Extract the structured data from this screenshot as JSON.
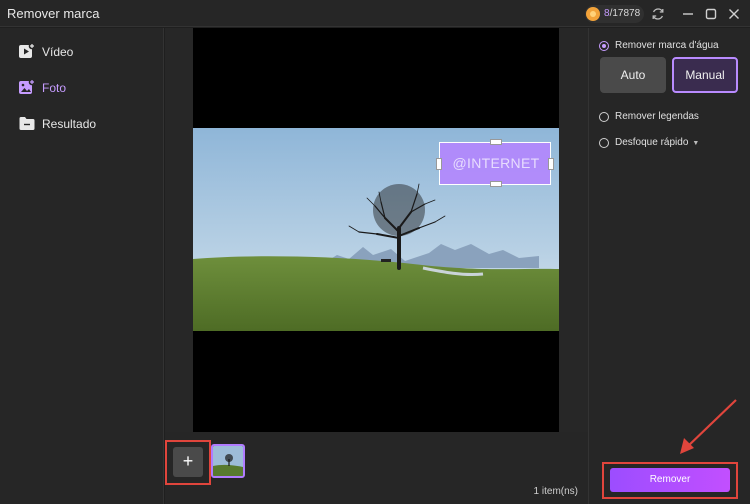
{
  "window": {
    "title": "Remover marca"
  },
  "credits": {
    "used": "8",
    "total": "/17878"
  },
  "sidebar": {
    "items": [
      {
        "label": "Vídeo",
        "icon": "video-add-icon"
      },
      {
        "label": "Foto",
        "icon": "image-add-icon"
      },
      {
        "label": "Resultado",
        "icon": "folder-icon"
      }
    ]
  },
  "canvas": {
    "watermark_text": "@INTERNET"
  },
  "strip": {
    "add_label": "+",
    "count": "1 item(ns)"
  },
  "right_panel": {
    "options": [
      {
        "label": "Remover marca d'água",
        "checked": true
      },
      {
        "label": "Remover legendas",
        "checked": false
      },
      {
        "label": "Desfoque rápido",
        "checked": false
      }
    ],
    "modes": {
      "auto": "Auto",
      "manual": "Manual"
    },
    "remove_button": "Remover"
  },
  "colors": {
    "accent": "#b98bff",
    "highlight": "#e0453c",
    "button_gradient_start": "#9c4dff",
    "button_gradient_end": "#c24fff"
  }
}
